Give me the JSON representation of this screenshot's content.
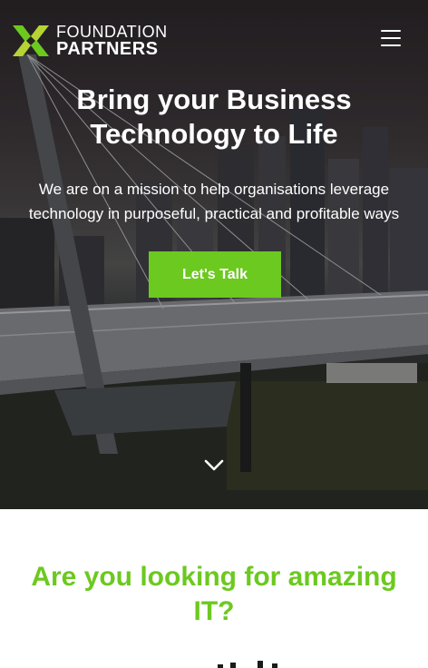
{
  "logo": {
    "line1": "FOUNDATION",
    "line2": "PARTNERS",
    "mark_colors": [
      "#6cc91f",
      "#b5d433"
    ]
  },
  "header": {
    "menu_icon": "hamburger-menu-icon"
  },
  "hero": {
    "title": "Bring your Business Technology to Life",
    "subtitle": "We are on a mission to help organisations leverage technology in purposeful, practical and profitable ways",
    "cta_label": "Let's Talk",
    "scroll_icon": "chevron-down-icon"
  },
  "section": {
    "title": "Are you looking for amazing IT?"
  },
  "colors": {
    "accent": "#6cc91f",
    "text_light": "#ffffff"
  }
}
